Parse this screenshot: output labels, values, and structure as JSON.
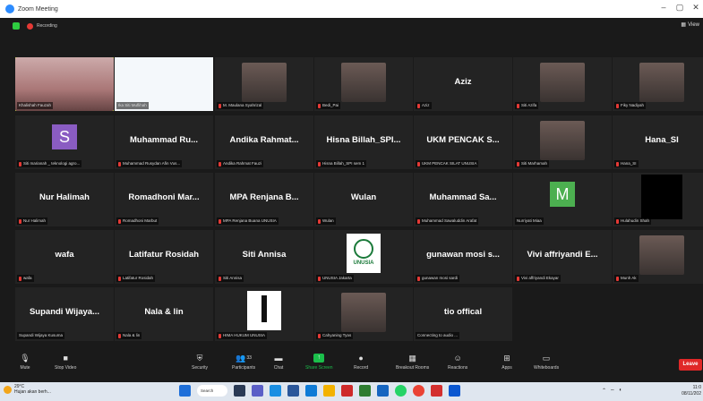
{
  "window": {
    "title": "Zoom Meeting",
    "minimize": "–",
    "maximize": "▢",
    "close": "✕"
  },
  "status": {
    "recording_label": "Recording",
    "view_label": "View"
  },
  "tiles": [
    {
      "id": "t1",
      "caption": "Khalishah Fauzah",
      "kind": "photo",
      "active": true
    },
    {
      "id": "t2",
      "caption": "Ika Siti Muflihah",
      "kind": "slide"
    },
    {
      "id": "t3",
      "caption": "M. Maulana Syahrizal",
      "kind": "photo",
      "muted": true
    },
    {
      "id": "t4",
      "caption": "Bedi_Pai",
      "kind": "photo",
      "muted": true
    },
    {
      "id": "t5",
      "big": "Aziz",
      "caption": "Aziz",
      "muted": true
    },
    {
      "id": "t6",
      "caption": "Siti Azifa",
      "kind": "photo",
      "muted": true
    },
    {
      "id": "t7",
      "caption": "Fiky Nadiyah",
      "kind": "photo",
      "muted": true
    },
    {
      "id": "t8",
      "avatar": "S",
      "avatar_color": "#8a5cc2",
      "caption": "Siti marianah _ teknologi agro...",
      "muted": true
    },
    {
      "id": "t9",
      "big": "Muhammad Ru...",
      "caption": "Muhammad Rusydan Afin Vus...",
      "muted": true
    },
    {
      "id": "t10",
      "big": "Andika Rahmat...",
      "caption": "Andika Rahmat Fauzi",
      "muted": true
    },
    {
      "id": "t11",
      "big": "Hisna Billah_SPI...",
      "caption": "Hisna Billah_SPI sem 1",
      "muted": true
    },
    {
      "id": "t12",
      "big": "UKM PENCAK S...",
      "caption": "UKM PENCAK SILAT UNUSIA",
      "muted": true
    },
    {
      "id": "t13",
      "caption": "Siti Marhamah",
      "kind": "photo",
      "muted": true
    },
    {
      "id": "t14",
      "big": "Hana_SI",
      "caption": "Hana_SI",
      "muted": true
    },
    {
      "id": "t15",
      "big": "Nur Halimah",
      "caption": "Nur Halimah",
      "muted": true
    },
    {
      "id": "t16",
      "big": "Romadhoni Mar...",
      "caption": "Romadhoni Marbut",
      "muted": true
    },
    {
      "id": "t17",
      "big": "MPA Renjana B...",
      "caption": "MPA Renjana Buana UNUSIA",
      "muted": true
    },
    {
      "id": "t18",
      "big": "Wulan",
      "caption": "Wulan",
      "muted": true
    },
    {
      "id": "t19",
      "big": "Muhammad Sa...",
      "caption": "Muhammad Sawaluddin Arafat",
      "muted": true
    },
    {
      "id": "t20",
      "avatar": "M",
      "avatar_color": "#4caf50",
      "caption": "Nurriyati Miaa"
    },
    {
      "id": "t21",
      "caption": "Hulahudin Shah",
      "kind": "dark",
      "muted": true
    },
    {
      "id": "t22",
      "big": "wafa",
      "caption": "wafa",
      "muted": true
    },
    {
      "id": "t23",
      "big": "Latifatur Rosidah",
      "caption": "Latifatur Rosidah",
      "muted": true
    },
    {
      "id": "t24",
      "big": "Siti Annisa",
      "caption": "Siti Annisa",
      "muted": true
    },
    {
      "id": "t25",
      "caption": "UNUSIA Jakarta",
      "kind": "logo-unusia",
      "muted": true,
      "logo_text": "UNUSIA"
    },
    {
      "id": "t26",
      "big": "gunawan mosi s...",
      "caption": "gunawan mosi sardi",
      "muted": true
    },
    {
      "id": "t27",
      "big": "Vivi affriyandi E...",
      "caption": "Vivi affriyandi Ekayar",
      "muted": true
    },
    {
      "id": "t28",
      "caption": "Munh Ak",
      "kind": "photo",
      "muted": true
    },
    {
      "id": "t29",
      "big": "Supandi Wijaya...",
      "caption": "Supandi Wijaya Kusuma"
    },
    {
      "id": "t30",
      "big": "Nala & lin",
      "caption": "Nala & lin",
      "muted": true
    },
    {
      "id": "t31",
      "caption": "HIMA HUKUM UNUSIA",
      "kind": "logo-hima",
      "muted": true
    },
    {
      "id": "t32",
      "caption": "Cahyaning Tyas",
      "kind": "photo",
      "muted": true
    },
    {
      "id": "t33",
      "big": "tio offical",
      "caption": "Connecting to audio ..."
    }
  ],
  "toolbar": {
    "mute": "Mute",
    "stop_video": "Stop Video",
    "security": "Security",
    "participants": "Participants",
    "participants_count": "33",
    "chat": "Chat",
    "share": "Share Screen",
    "record": "Record",
    "breakout": "Breakout Rooms",
    "reactions": "Reactions",
    "apps": "Apps",
    "whiteboards": "Whiteboards",
    "leave": "Leave"
  },
  "taskbar": {
    "temp": "29°C",
    "weather": "Hujan akan berh...",
    "search": "Search",
    "time": "11:0",
    "date": "08/11/202"
  },
  "colors": {
    "accent": "#2d8cff",
    "active_border": "#c6e23a",
    "share_green": "#1bbf4b",
    "leave_red": "#e02828"
  }
}
